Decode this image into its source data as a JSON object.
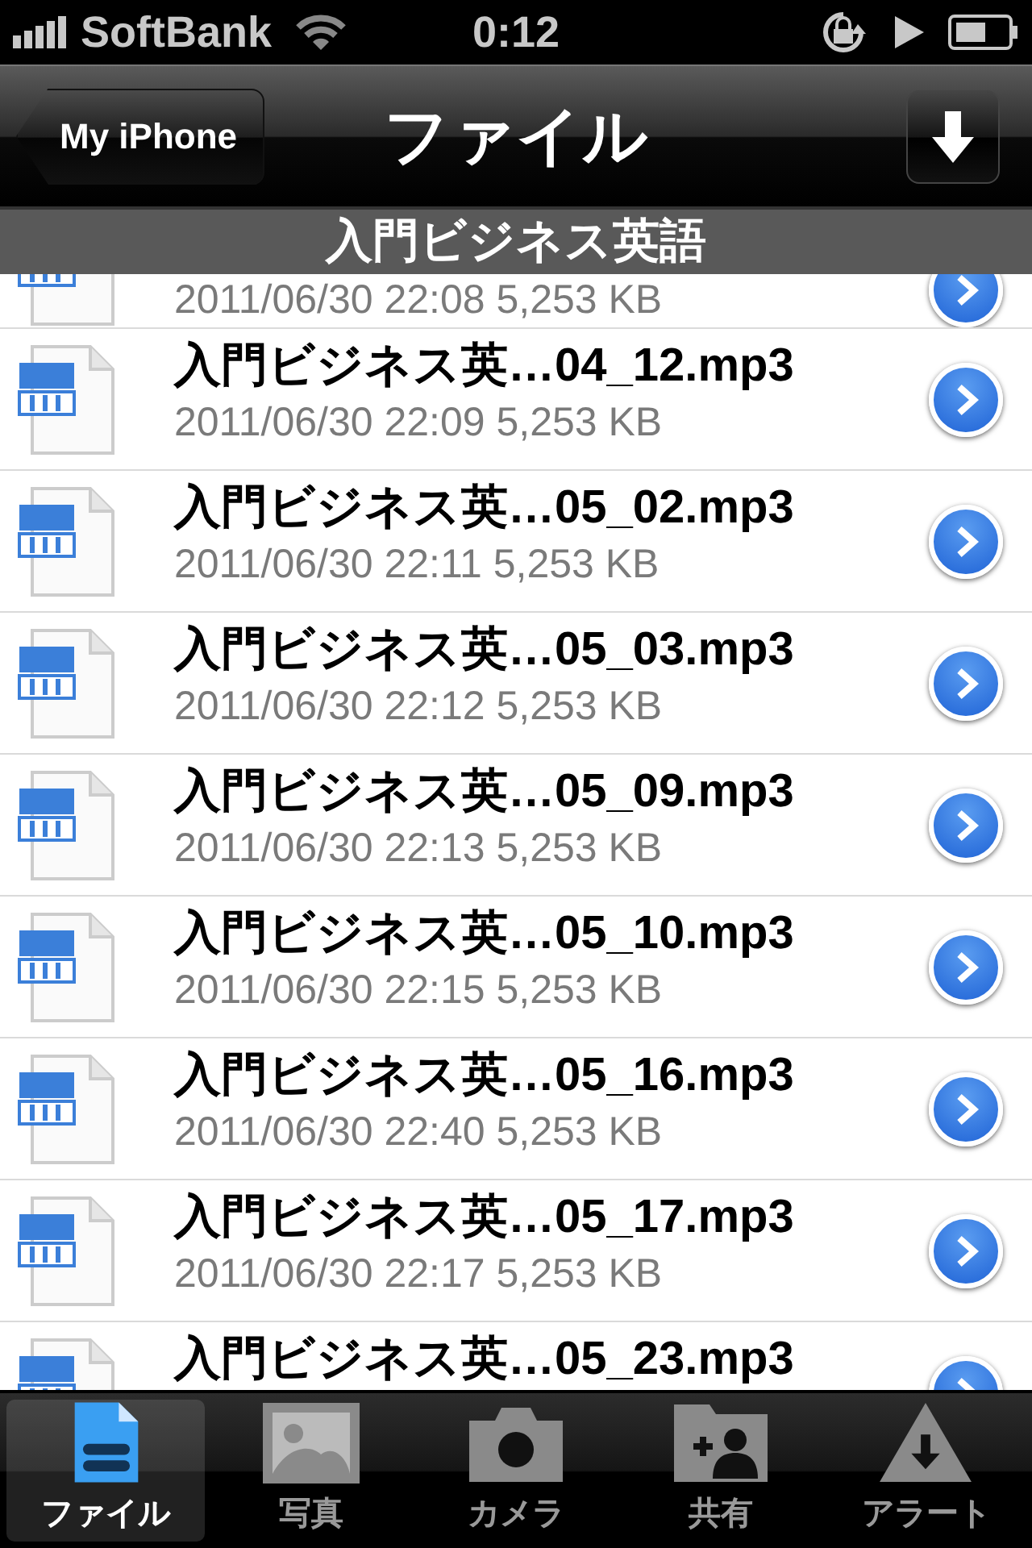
{
  "status_bar": {
    "carrier": "SoftBank",
    "time": "0:12"
  },
  "nav_bar": {
    "back_button": "My iPhone",
    "title": "ファイル"
  },
  "section_header": "入門ビジネス英語",
  "files": [
    {
      "meta": "2011/06/30 22:08 5,253 KB"
    },
    {
      "title": "入門ビジネス英…04_12.mp3",
      "meta": "2011/06/30 22:09 5,253 KB"
    },
    {
      "title": "入門ビジネス英…05_02.mp3",
      "meta": "2011/06/30 22:11 5,253 KB"
    },
    {
      "title": "入門ビジネス英…05_03.mp3",
      "meta": "2011/06/30 22:12 5,253 KB"
    },
    {
      "title": "入門ビジネス英…05_09.mp3",
      "meta": "2011/06/30 22:13 5,253 KB"
    },
    {
      "title": "入門ビジネス英…05_10.mp3",
      "meta": "2011/06/30 22:15 5,253 KB"
    },
    {
      "title": "入門ビジネス英…05_16.mp3",
      "meta": "2011/06/30 22:40 5,253 KB"
    },
    {
      "title": "入門ビジネス英…05_17.mp3",
      "meta": "2011/06/30 22:17 5,253 KB"
    },
    {
      "title": "入門ビジネス英…05_23.mp3"
    }
  ],
  "tab_bar": [
    {
      "kind": "file",
      "label": "ファイル",
      "selected": true
    },
    {
      "kind": "photo",
      "label": "写真",
      "selected": false
    },
    {
      "kind": "camera",
      "label": "カメラ",
      "selected": false
    },
    {
      "kind": "share",
      "label": "共有",
      "selected": false
    },
    {
      "kind": "alert",
      "label": "アラート",
      "selected": false
    }
  ]
}
